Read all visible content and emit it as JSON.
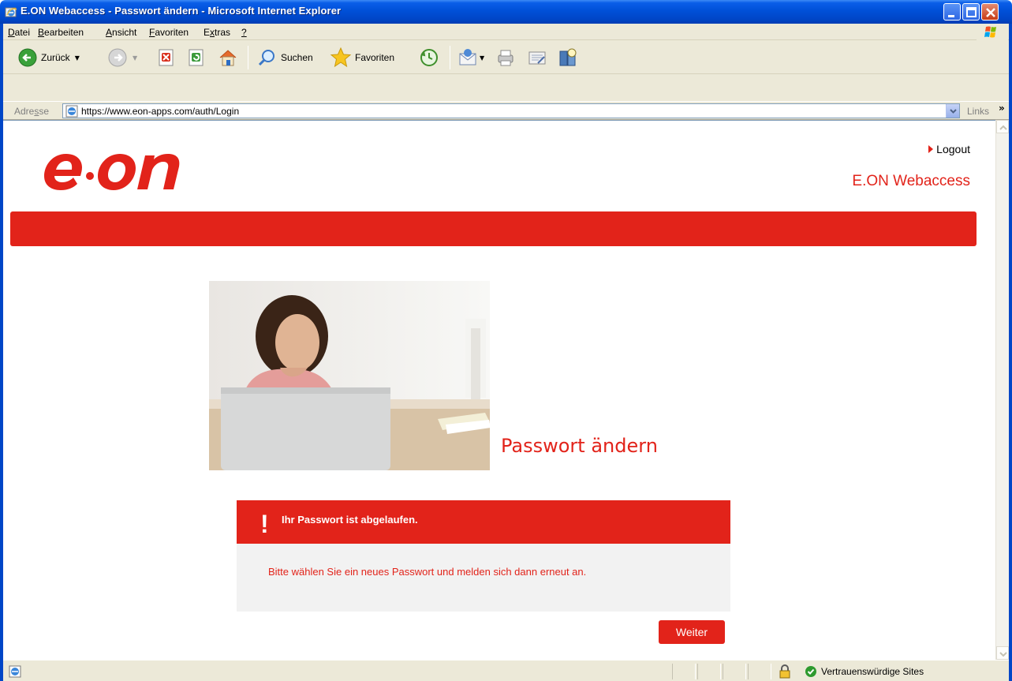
{
  "window": {
    "title": "E.ON Webaccess - Passwort ändern - Microsoft Internet Explorer"
  },
  "menu": {
    "items": [
      {
        "pre": "",
        "accel": "D",
        "post": "atei"
      },
      {
        "pre": "",
        "accel": "B",
        "post": "earbeiten"
      },
      {
        "pre": "",
        "accel": "A",
        "post": "nsicht"
      },
      {
        "pre": "",
        "accel": "F",
        "post": "avoriten"
      },
      {
        "pre": "E",
        "accel": "x",
        "post": "tras"
      },
      {
        "pre": "",
        "accel": "?",
        "post": ""
      }
    ]
  },
  "toolbar": {
    "back_label": "Zurück",
    "search_label": "Suchen",
    "favorites_label": "Favoriten"
  },
  "address": {
    "label_pre": "Adre",
    "label_accel": "s",
    "label_post": "se",
    "url": "https://www.eon-apps.com/auth/Login",
    "links_label": "Links",
    "links_arrow": "»"
  },
  "page": {
    "logout_label": "Logout",
    "site_name": "E.ON Webaccess",
    "title": "Passwort ändern",
    "message_icon": "!",
    "message_title": "Ihr Passwort ist abgelaufen.",
    "message_body": "Bitte wählen Sie ein neues Passwort und melden sich dann erneut an.",
    "continue_label": "Weiter"
  },
  "status": {
    "zone": "Vertrauenswürdige Sites"
  },
  "colors": {
    "eon_red": "#e2231a",
    "xp_blue": "#0046c7"
  }
}
